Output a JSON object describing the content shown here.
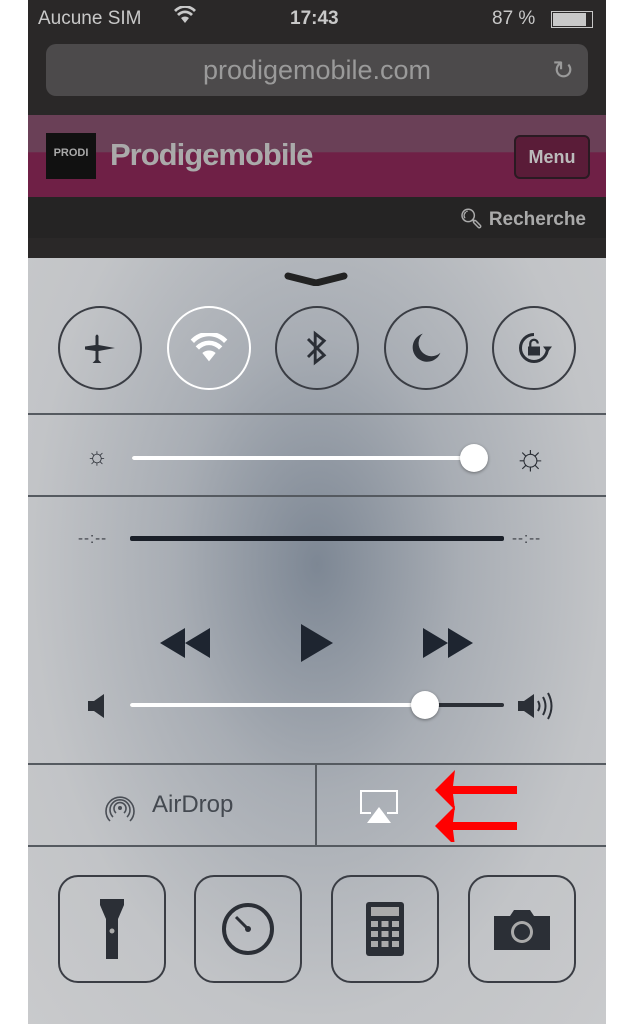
{
  "status_bar": {
    "carrier": "Aucune SIM",
    "time": "17:43",
    "battery": "87 %",
    "battery_level": 0.87
  },
  "browser": {
    "url": "prodigemobile.com",
    "reload_icon": "reload-icon"
  },
  "site": {
    "logo_text": "PRODI",
    "name": "Prodigemobile",
    "menu_label": "Menu",
    "search_label": "Recherche"
  },
  "control_center": {
    "toggles": [
      {
        "name": "airplane-mode",
        "on": false
      },
      {
        "name": "wifi",
        "on": true
      },
      {
        "name": "bluetooth",
        "on": false
      },
      {
        "name": "do-not-disturb",
        "on": false
      },
      {
        "name": "rotation-lock",
        "on": false
      }
    ],
    "brightness": 0.96,
    "media": {
      "elapsed": "--:--",
      "remaining": "--:--"
    },
    "volume": 0.79,
    "airdrop_label": "AirDrop",
    "shortcuts": [
      "flashlight",
      "timer",
      "calculator",
      "camera"
    ],
    "annotation_color": "#ff0000"
  }
}
